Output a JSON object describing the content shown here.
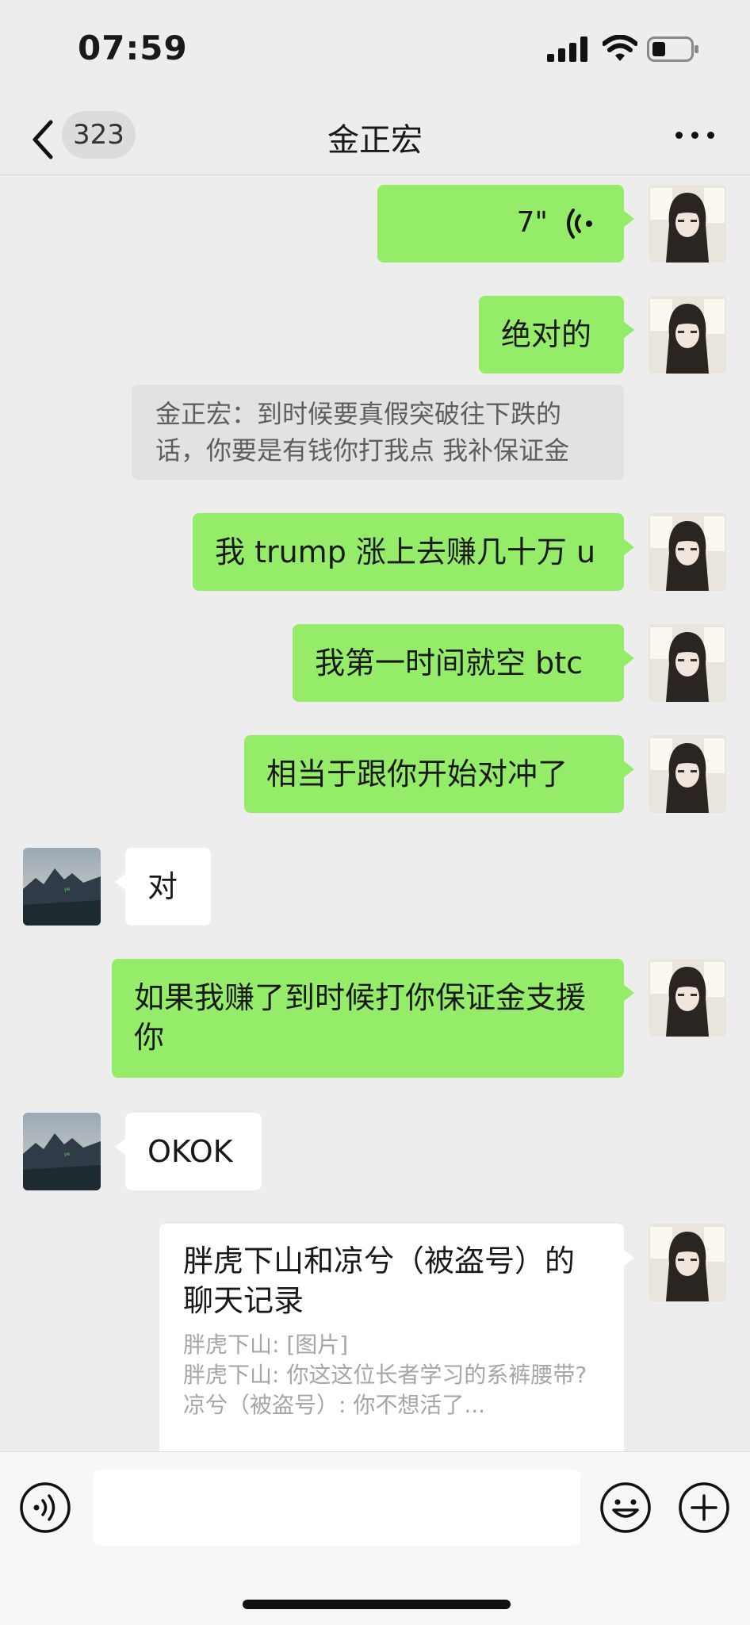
{
  "status": {
    "time": "07:59"
  },
  "nav": {
    "back_count": "323",
    "title": "金正宏"
  },
  "messages": {
    "m1": {
      "duration": "7\""
    },
    "m2": {
      "text": "绝对的"
    },
    "quote": {
      "text": "金正宏：到时候要真假突破往下跌的话，你要是有钱你打我点 我补保证金"
    },
    "m3": {
      "text": "我 trump 涨上去赚几十万 u"
    },
    "m4": {
      "text": "我第一时间就空 btc"
    },
    "m5": {
      "text": "相当于跟你开始对冲了"
    },
    "m6": {
      "text": "对"
    },
    "m7": {
      "text": "如果我赚了到时候打你保证金支援你"
    },
    "m8": {
      "text": "OKOK"
    },
    "card": {
      "title": "胖虎下山和凉兮（被盗号）的聊天记录",
      "lines": [
        "胖虎下山: [图片]",
        "胖虎下山: 你这这位长者学习的系裤腰带?",
        "凉兮（被盗号）: 你不想活了..."
      ]
    }
  },
  "icons": {
    "back": "chevron-left-icon",
    "more": "more-dots-icon",
    "voice": "voice-wave-icon",
    "voice_input": "voice-input-icon",
    "emoji": "emoji-icon",
    "plus": "plus-icon"
  },
  "colors": {
    "sent_bubble": "#95ec69",
    "received_bubble": "#ffffff",
    "background": "#ededed"
  }
}
